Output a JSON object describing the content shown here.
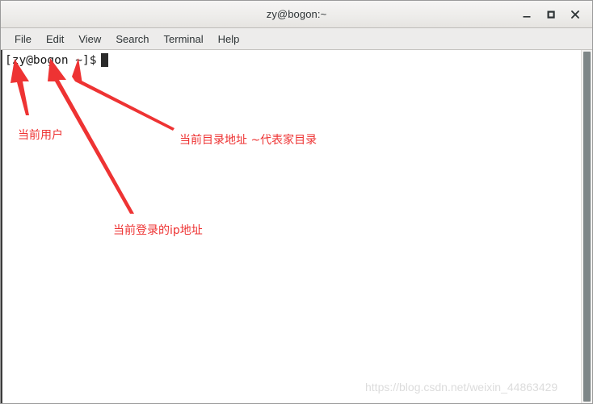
{
  "window": {
    "title": "zy@bogon:~",
    "controls": [
      {
        "name": "minimize",
        "glyph": "minimize-icon"
      },
      {
        "name": "maximize",
        "glyph": "maximize-icon"
      },
      {
        "name": "close",
        "glyph": "close-icon"
      }
    ]
  },
  "menubar": {
    "items": [
      {
        "label": "File"
      },
      {
        "label": "Edit"
      },
      {
        "label": "View"
      },
      {
        "label": "Search"
      },
      {
        "label": "Terminal"
      },
      {
        "label": "Help"
      }
    ]
  },
  "terminal": {
    "prompt": "[zy@bogon ~]$",
    "cursor": "block"
  },
  "annotations": {
    "color": "#ee3333",
    "items": [
      {
        "id": "user",
        "text": "当前用户"
      },
      {
        "id": "directory",
        "text": "当前目录地址 ~代表家目录"
      },
      {
        "id": "ip",
        "text": "当前登录的ip地址"
      }
    ]
  },
  "watermark": {
    "text": "https://blog.csdn.net/weixin_44863429"
  },
  "colors": {
    "annotation_red": "#ee3333",
    "titlebar": "#edecea",
    "menubar": "#edeceb",
    "terminal_bg": "#ffffff",
    "terminal_text": "#1a1a1a",
    "scrollbar_thumb": "#7e8687",
    "watermark_text": "#dcdcdc"
  }
}
